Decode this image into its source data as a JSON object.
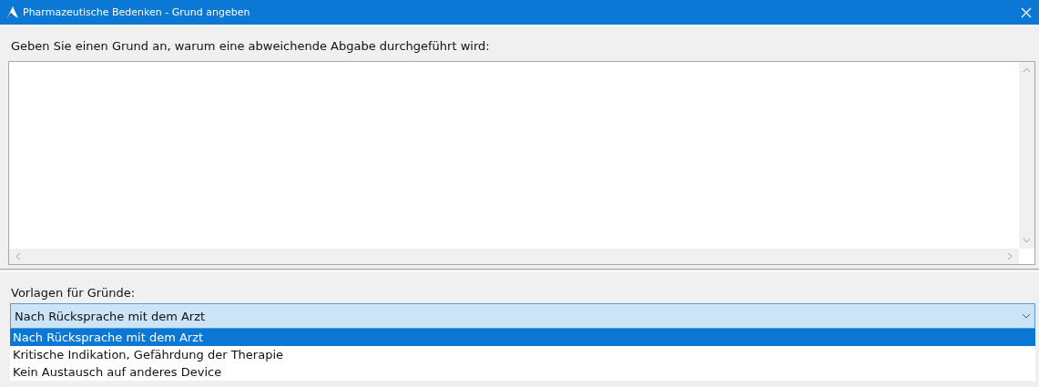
{
  "window": {
    "title": "Pharmazeutische Bedenken - Grund angeben"
  },
  "prompt": "Geben Sie einen Grund an, warum eine abweichende Abgabe durchgeführt wird:",
  "templates": {
    "label": "Vorlagen für Gründe:",
    "value": "Nach Rücksprache mit dem Arzt",
    "expanded": true,
    "options": [
      {
        "label": "Nach Rücksprache mit dem Arzt",
        "selected": true
      },
      {
        "label": "Kritische Indikation, Gefährdung der Therapie",
        "selected": false
      },
      {
        "label": "Kein Austausch auf anderes Device",
        "selected": false
      }
    ]
  }
}
